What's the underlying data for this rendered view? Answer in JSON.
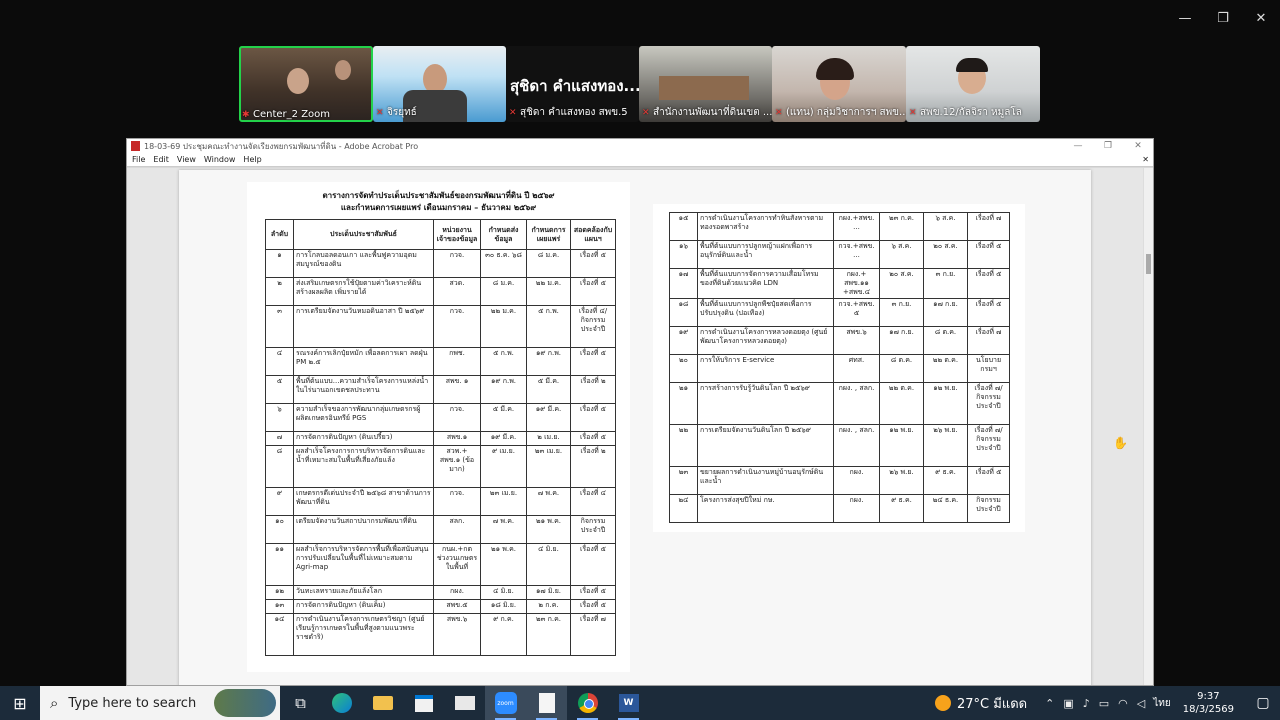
{
  "zoom": {
    "controls": [
      "—",
      "❐",
      "✕"
    ],
    "participants": [
      {
        "name": "Center_2 Zoom",
        "active": true
      },
      {
        "name": "จิรยุทธ์",
        "active": false
      },
      {
        "name": "สุชิดา คำแสงทอง สพข.5",
        "big_name": "สุชิดา คำแสงทอง...",
        "active": false
      },
      {
        "name": "สำนักงานพัฒนาที่ดินเขต ...",
        "active": false
      },
      {
        "name": "(แทน) กลุ่มวิชาการฯ สพข...",
        "active": false
      },
      {
        "name": "สพข.12/กัลจิรา หมูลโล",
        "active": false
      }
    ]
  },
  "acrobat": {
    "title": "18-03-69 ประชุมคณะทำงานจัดเรียงพยกรมพัฒนาที่ดิน - Adobe Acrobat Pro",
    "menu": [
      "File",
      "Edit",
      "View",
      "Window",
      "Help"
    ],
    "doc_title_1": "ตารางการจัดทำประเด็นประชาสัมพันธ์ของกรมพัฒนาที่ดิน ปี ๒๕๖๙",
    "doc_title_2": "และกำหนดการเผยแพร่ เดือนมกราคม – ธันวาคม ๒๕๖๙",
    "headers": [
      "ลำดับ",
      "ประเด็นประชาสัมพันธ์",
      "หน่วยงานเจ้าของข้อมูล",
      "กำหนดส่งข้อมูล",
      "กำหนดการเผยแพร่",
      "สอดคล้องกับแผนฯ"
    ],
    "rows_left": [
      [
        "๑",
        "การโกลบอลดอนเกา และพื้นฟูความอุดมสมบูรณ์ของดิน",
        "กวจ.",
        "๓๐ ธ.ค. ๖๘",
        "๘ ม.ค.",
        "เรื่องที่ ๕"
      ],
      [
        "๒",
        "ส่งเสริมเกษตรกรใช้ปุ๋ยตามค่าวิเคราะห์ดิน สร้างผลผลิต เพิ่มรายได้",
        "สวด.",
        "๘ ม.ค.",
        "๒๒ ม.ค.",
        "เรื่องที่ ๕"
      ],
      [
        "๓",
        "การเตรียมจัดงานวันหมอดินอาสา ปี ๒๕๖๙",
        "กวจ.",
        "๒๒ ม.ค.",
        "๕ ก.พ.",
        "เรื่องที่ ๔/ กิจกรรมประจำปี"
      ],
      [
        "๔",
        "รณรงค์การเลิกปุ๋ยหมัก เพื่อลดการเผา ลดฝุ่น PM ๒.๕",
        "กพช.",
        "๕ ก.พ.",
        "๑๙ ก.พ.",
        "เรื่องที่ ๕"
      ],
      [
        "๕",
        "พื้นที่ต้นแบบ...ความสำเร็จโครงการแหล่งน้ำในไร่นานอกเขตชลประทาน",
        "สพข. ๑",
        "๑๙ ก.พ.",
        "๕ มี.ค.",
        "เรื่องที่ ๒"
      ],
      [
        "๖",
        "ความสำเร็จของการพัฒนากลุ่มเกษตรกรผู้ผลิตเกษตรอินทรีย์ PGS",
        "กวจ.",
        "๕ มี.ค.",
        "๑๙ มี.ค.",
        "เรื่องที่ ๕"
      ],
      [
        "๗",
        "การจัดการดินปัญหา (ดินเปรี้ยว)",
        "สพข.๑",
        "๑๙ มี.ค.",
        "๒ เม.ย.",
        "เรื่องที่ ๕"
      ],
      [
        "๘",
        "ผลสำเร็จโครงการการบริหารจัดการดินและน้ำที่เหมาะสมในพื้นที่เสี่ยงภัยแล้ง",
        "สวพ.+ สพข.๑ (ข้อมาก)",
        "๙ เม.ย.",
        "๒๓ เม.ย.",
        "เรื่องที่ ๒"
      ],
      [
        "๙",
        "เกษตรกรดีเด่นประจำปี ๒๕๖๘ สาขาด้านการพัฒนาที่ดิน",
        "กวจ.",
        "๒๓ เม.ย.",
        "๗ พ.ค.",
        "เรื่องที่ ๔"
      ],
      [
        "๑๐",
        "เตรียมจัดงานวันสถาปนากรมพัฒนาที่ดิน",
        "สลก.",
        "๗ พ.ค.",
        "๒๑ พ.ค.",
        "กิจกรรมประจำปี"
      ],
      [
        "๑๑",
        "ผลสำเร็จการบริหารจัดการพื้นที่เพื่อสนับสนุนการปรับเปลี่ยนในพื้นที่ไม่เหมาะสมตาม Agri-map",
        "กนผ.+กต ช่วงวนเกษตร ในพื้นที่",
        "๒๑ พ.ค.",
        "๔ มิ.ย.",
        "เรื่องที่ ๕"
      ],
      [
        "๑๒",
        "วันทะเลทรายและภัยแล้งโลก",
        "กผง.",
        "๔ มิ.ย.",
        "๑๗ มิ.ย.",
        "เรื่องที่ ๕"
      ],
      [
        "๑๓",
        "การจัดการดินปัญหา (ดินเค็ม)",
        "สพข.๕",
        "๑๘ มิ.ย.",
        "๒ ก.ค.",
        "เรื่องที่ ๕"
      ],
      [
        "๑๔",
        "การดำเนินงานโครงการเกษตรวิชญา (ศูนย์เรียนรู้การเกษตรในพื้นที่สูงตามแนวพระราชดำริ)",
        "สพข.๖",
        "๙ ก.ค.",
        "๒๓ ก.ค.",
        "เรื่องที่ ๗"
      ]
    ],
    "rows_right": [
      [
        "๑๕",
        "การดำเนินงานโครงการทำหินสังหารตามทองรอดพาสร้าง",
        "กผง.+สพข. ...",
        "๒๓ ก.ค.",
        "๖ ส.ค.",
        "เรื่องที่ ๗"
      ],
      [
        "๑๖",
        "พื้นที่ต้นแบบการปลูกหญ้าแฝกเพื่อการอนุรักษ์ดินและน้ำ",
        "กวจ.+สพข. ...",
        "๖ ส.ค.",
        "๒๐ ส.ค.",
        "เรื่องที่ ๕"
      ],
      [
        "๑๗",
        "พื้นที่ต้นแบบการจัดการความเสื่อมโทรมของที่ดินด้วยแนวคิด LDN",
        "กผง.+ สพข.๑๑ +สพข.๔",
        "๒๐ ส.ค.",
        "๓ ก.ย.",
        "เรื่องที่ ๕"
      ],
      [
        "๑๘",
        "พื้นที่ต้นแบบการปลูกพืชปุ๋ยสดเพื่อการปรับปรุงดิน (ปอเทือง)",
        "กวจ.+สพข. ๕",
        "๓ ก.ย.",
        "๑๗ ก.ย.",
        "เรื่องที่ ๕"
      ],
      [
        "๑๙",
        "การดำเนินงานโครงการหลวงดอยตุง (ศูนย์พัฒนาโครงการหลวงดอยตุง)",
        "สพข.๖",
        "๑๗ ก.ย.",
        "๘ ต.ค.",
        "เรื่องที่ ๗"
      ],
      [
        "๒๐",
        "การให้บริการ E-service",
        "ศทส.",
        "๘ ต.ค.",
        "๒๒ ต.ค.",
        "นโยบายกรมฯ"
      ],
      [
        "๒๑",
        "การสร้างการรับรู้วันดินโลก ปี ๒๕๖๙",
        "กผง. , สลก.",
        "๒๒ ต.ค.",
        "๑๒ พ.ย.",
        "เรื่องที่ ๗/ กิจกรรมประจำปี"
      ],
      [
        "๒๒",
        "การเตรียมจัดงานวันดินโลก ปี ๒๕๖๙",
        "กผง. , สลก.",
        "๑๒ พ.ย.",
        "๒๖ พ.ย.",
        "เรื่องที่ ๗/ กิจกรรมประจำปี"
      ],
      [
        "๒๓",
        "ขยายผลการดำเนินงานหมู่บ้านอนุรักษ์ดินและน้ำ",
        "กผง.",
        "๒๖ พ.ย.",
        "๙ ธ.ค.",
        "เรื่องที่ ๕"
      ],
      [
        "๒๔",
        "โครงการส่งสุขปีใหม่ กษ.",
        "กผง.",
        "๙ ธ.ค.",
        "๒๔ ธ.ค.",
        "กิจกรรมประจำปี"
      ]
    ]
  },
  "taskbar": {
    "search_placeholder": "Type here to search",
    "weather": "27°C มีแดด",
    "language": "ไทย",
    "time": "9:37",
    "date": "18/3/2569",
    "zoom_label": "zoom",
    "word_label": "W",
    "accent": "#2d8cff"
  }
}
